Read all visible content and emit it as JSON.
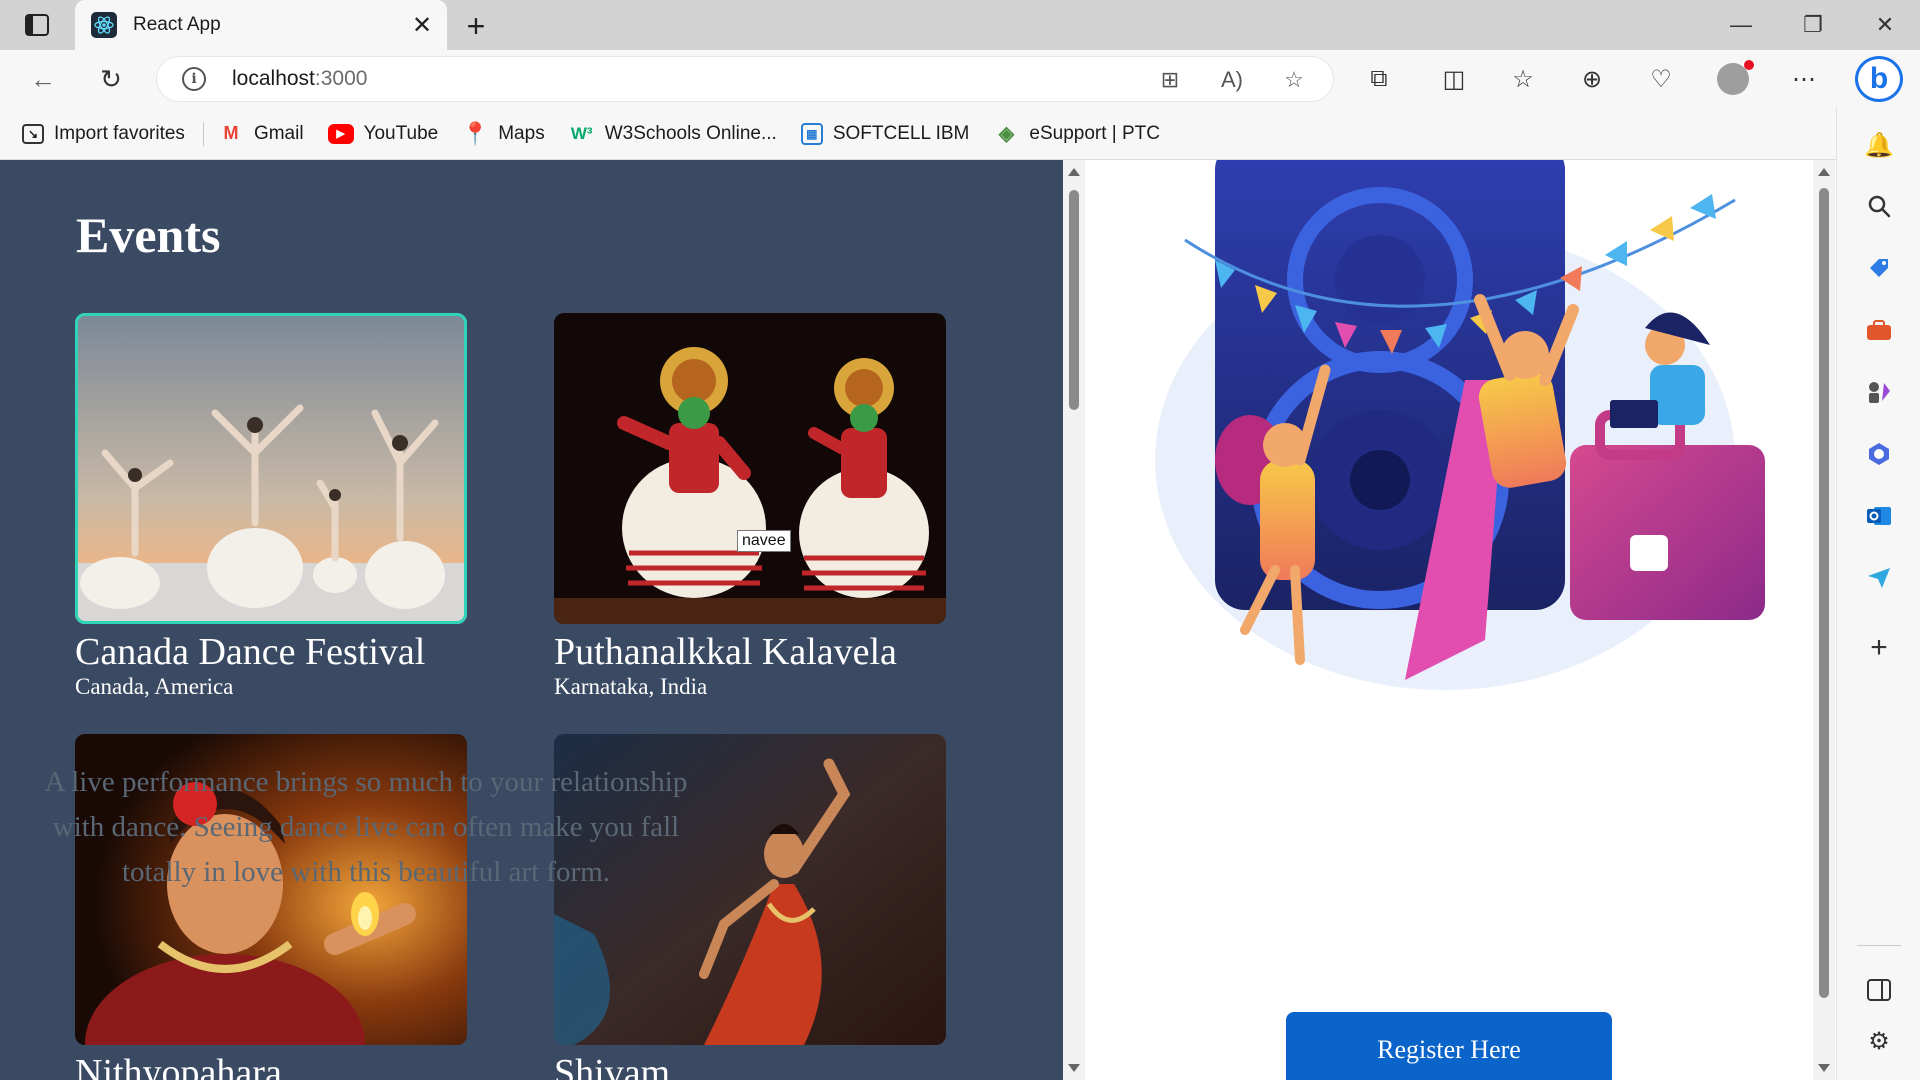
{
  "browser": {
    "tab_title": "React App",
    "url_host": "localhost",
    "url_port": ":3000",
    "bookmarks": [
      {
        "label": "Import favorites",
        "icon": "import-icon"
      },
      {
        "label": "Gmail",
        "icon": "gmail-icon"
      },
      {
        "label": "YouTube",
        "icon": "youtube-icon"
      },
      {
        "label": "Maps",
        "icon": "maps-icon"
      },
      {
        "label": "W3Schools Online...",
        "icon": "w3schools-icon"
      },
      {
        "label": "SOFTCELL IBM",
        "icon": "softcell-icon"
      },
      {
        "label": "eSupport | PTC",
        "icon": "esupport-icon"
      }
    ]
  },
  "page": {
    "events_title": "Events",
    "tooltip": "navee",
    "events": [
      {
        "name": "Canada Dance Festival",
        "place": "Canada, America"
      },
      {
        "name": "Puthanalkkal Kalavela",
        "place": "Karnataka, India"
      },
      {
        "name": "Nithyopahara",
        "place": ""
      },
      {
        "name": "Shivam",
        "place": ""
      }
    ],
    "description": "A live performance brings so much to your relationship with dance. Seeing dance live can often make you fall totally in love with this beautiful art form.",
    "register_label": "Register Here"
  },
  "colors": {
    "left_panel": "#3b4a63",
    "selected_outline": "#2fd3b8",
    "register_button": "#0a64c9"
  }
}
